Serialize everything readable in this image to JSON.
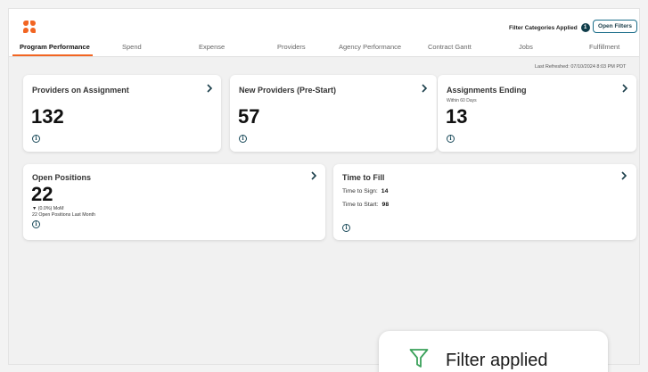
{
  "header": {
    "filter_categories_label": "Filter Categories Applied",
    "filter_count": "1",
    "open_filters_label": "Open Filters"
  },
  "tabs": [
    {
      "label": "Program Performance",
      "active": true
    },
    {
      "label": "Spend"
    },
    {
      "label": "Expense"
    },
    {
      "label": "Providers"
    },
    {
      "label": "Agency Performance"
    },
    {
      "label": "Contract Gantt"
    },
    {
      "label": "Jobs"
    },
    {
      "label": "Fulfillment"
    }
  ],
  "last_refreshed": "Last Refreshed: 07/10/2024 8:03 PM PDT",
  "cards": {
    "providers_on_assignment": {
      "title": "Providers on Assignment",
      "value": "132"
    },
    "new_providers": {
      "title": "New Providers (Pre-Start)",
      "value": "57"
    },
    "assignments_ending": {
      "title": "Assignments Ending",
      "subtitle": "Within 60 Days",
      "value": "13"
    },
    "open_positions": {
      "title": "Open Positions",
      "value": "22",
      "mom": "▼ (0.0%) MoM",
      "last_month": "22 Open Positions Last Month"
    },
    "time_to_fill": {
      "title": "Time to Fill",
      "time_to_sign_label": "Time to Sign:",
      "time_to_sign": "14",
      "time_to_start_label": "Time to Start:",
      "time_to_start": "98"
    }
  },
  "icons": {
    "info": "info-icon",
    "chevron": "chevron-right-icon",
    "filter": "filter-icon"
  },
  "colors": {
    "accent": "#f26522",
    "dark_teal": "#0f3d4a",
    "filter_green": "#3aa15a"
  },
  "toast": {
    "message": "Filter applied"
  }
}
